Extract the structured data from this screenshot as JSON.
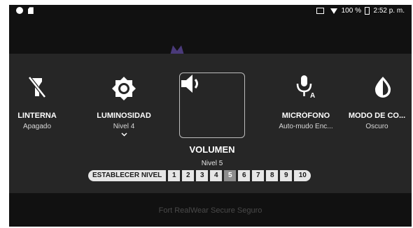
{
  "status_bar": {
    "battery": "100 %",
    "time": "2:52 p. m."
  },
  "background": {
    "footer_text": "Fort RealWear Secure Seguro"
  },
  "quick_settings": {
    "tiles": [
      {
        "label": "LINTERNA",
        "state": "Apagado",
        "icon": "flashlight-off-icon"
      },
      {
        "label": "LUMINOSIDAD",
        "state": "Nivel 4",
        "icon": "brightness-icon"
      },
      {
        "label": "VOLUMEN",
        "state": "Nivel 5",
        "icon": "volume-icon"
      },
      {
        "label": "MICRÓFONO",
        "state": "Auto-mudo Enc...",
        "icon": "microphone-auto-icon"
      },
      {
        "label": "MODO DE CO...",
        "state": "Oscuro",
        "icon": "dark-mode-icon"
      }
    ],
    "set_level_label": "ESTABLECER NIVEL",
    "levels": [
      "1",
      "2",
      "3",
      "4",
      "5",
      "6",
      "7",
      "8",
      "9",
      "10"
    ],
    "selected_level": "5"
  },
  "colors": {
    "screen_bg": "#111111",
    "panel_bg": "#262626",
    "chip_bg": "#e6e6e6",
    "chip_selected": "#8d8d8d"
  }
}
